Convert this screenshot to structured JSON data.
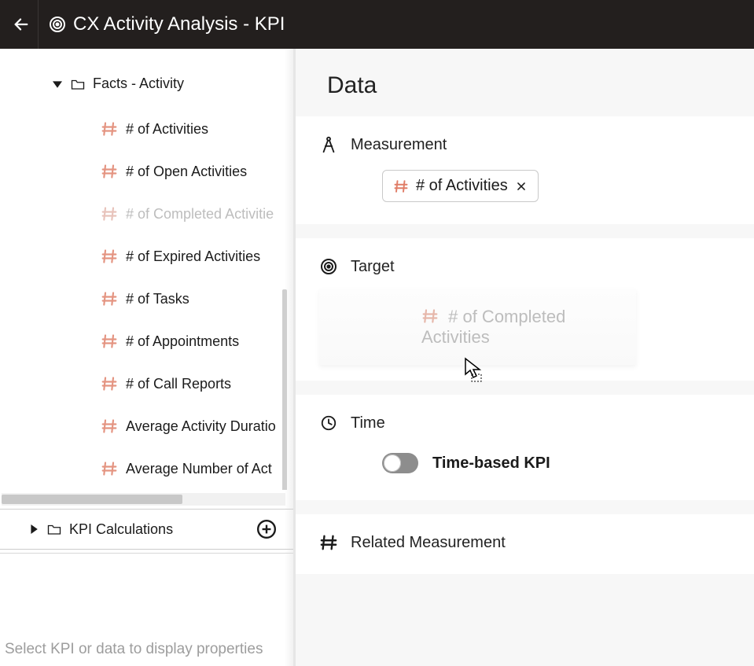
{
  "header": {
    "title": "CX Activity Analysis - KPI"
  },
  "sidebar": {
    "folder1": {
      "label": "Facts - Activity"
    },
    "items": [
      {
        "label": "# of Activities"
      },
      {
        "label": "# of Open Activities"
      },
      {
        "label": "# of Completed Activitie"
      },
      {
        "label": "# of Expired Activities"
      },
      {
        "label": "# of Tasks"
      },
      {
        "label": "# of Appointments"
      },
      {
        "label": "# of Call Reports"
      },
      {
        "label": "Average Activity Duratio"
      },
      {
        "label": "Average Number of Act"
      }
    ],
    "folder2": {
      "label": "KPI Calculations"
    },
    "footer_hint": "Select KPI or data to display properties"
  },
  "main": {
    "section_title": "Data",
    "measurement": {
      "heading": "Measurement",
      "chip_label": "# of Activities"
    },
    "target": {
      "heading": "Target",
      "ghost_label": "# of Completed Activities"
    },
    "time": {
      "heading": "Time",
      "toggle_label": "Time-based KPI",
      "toggle_on": false
    },
    "related": {
      "heading": "Related Measurement"
    }
  }
}
